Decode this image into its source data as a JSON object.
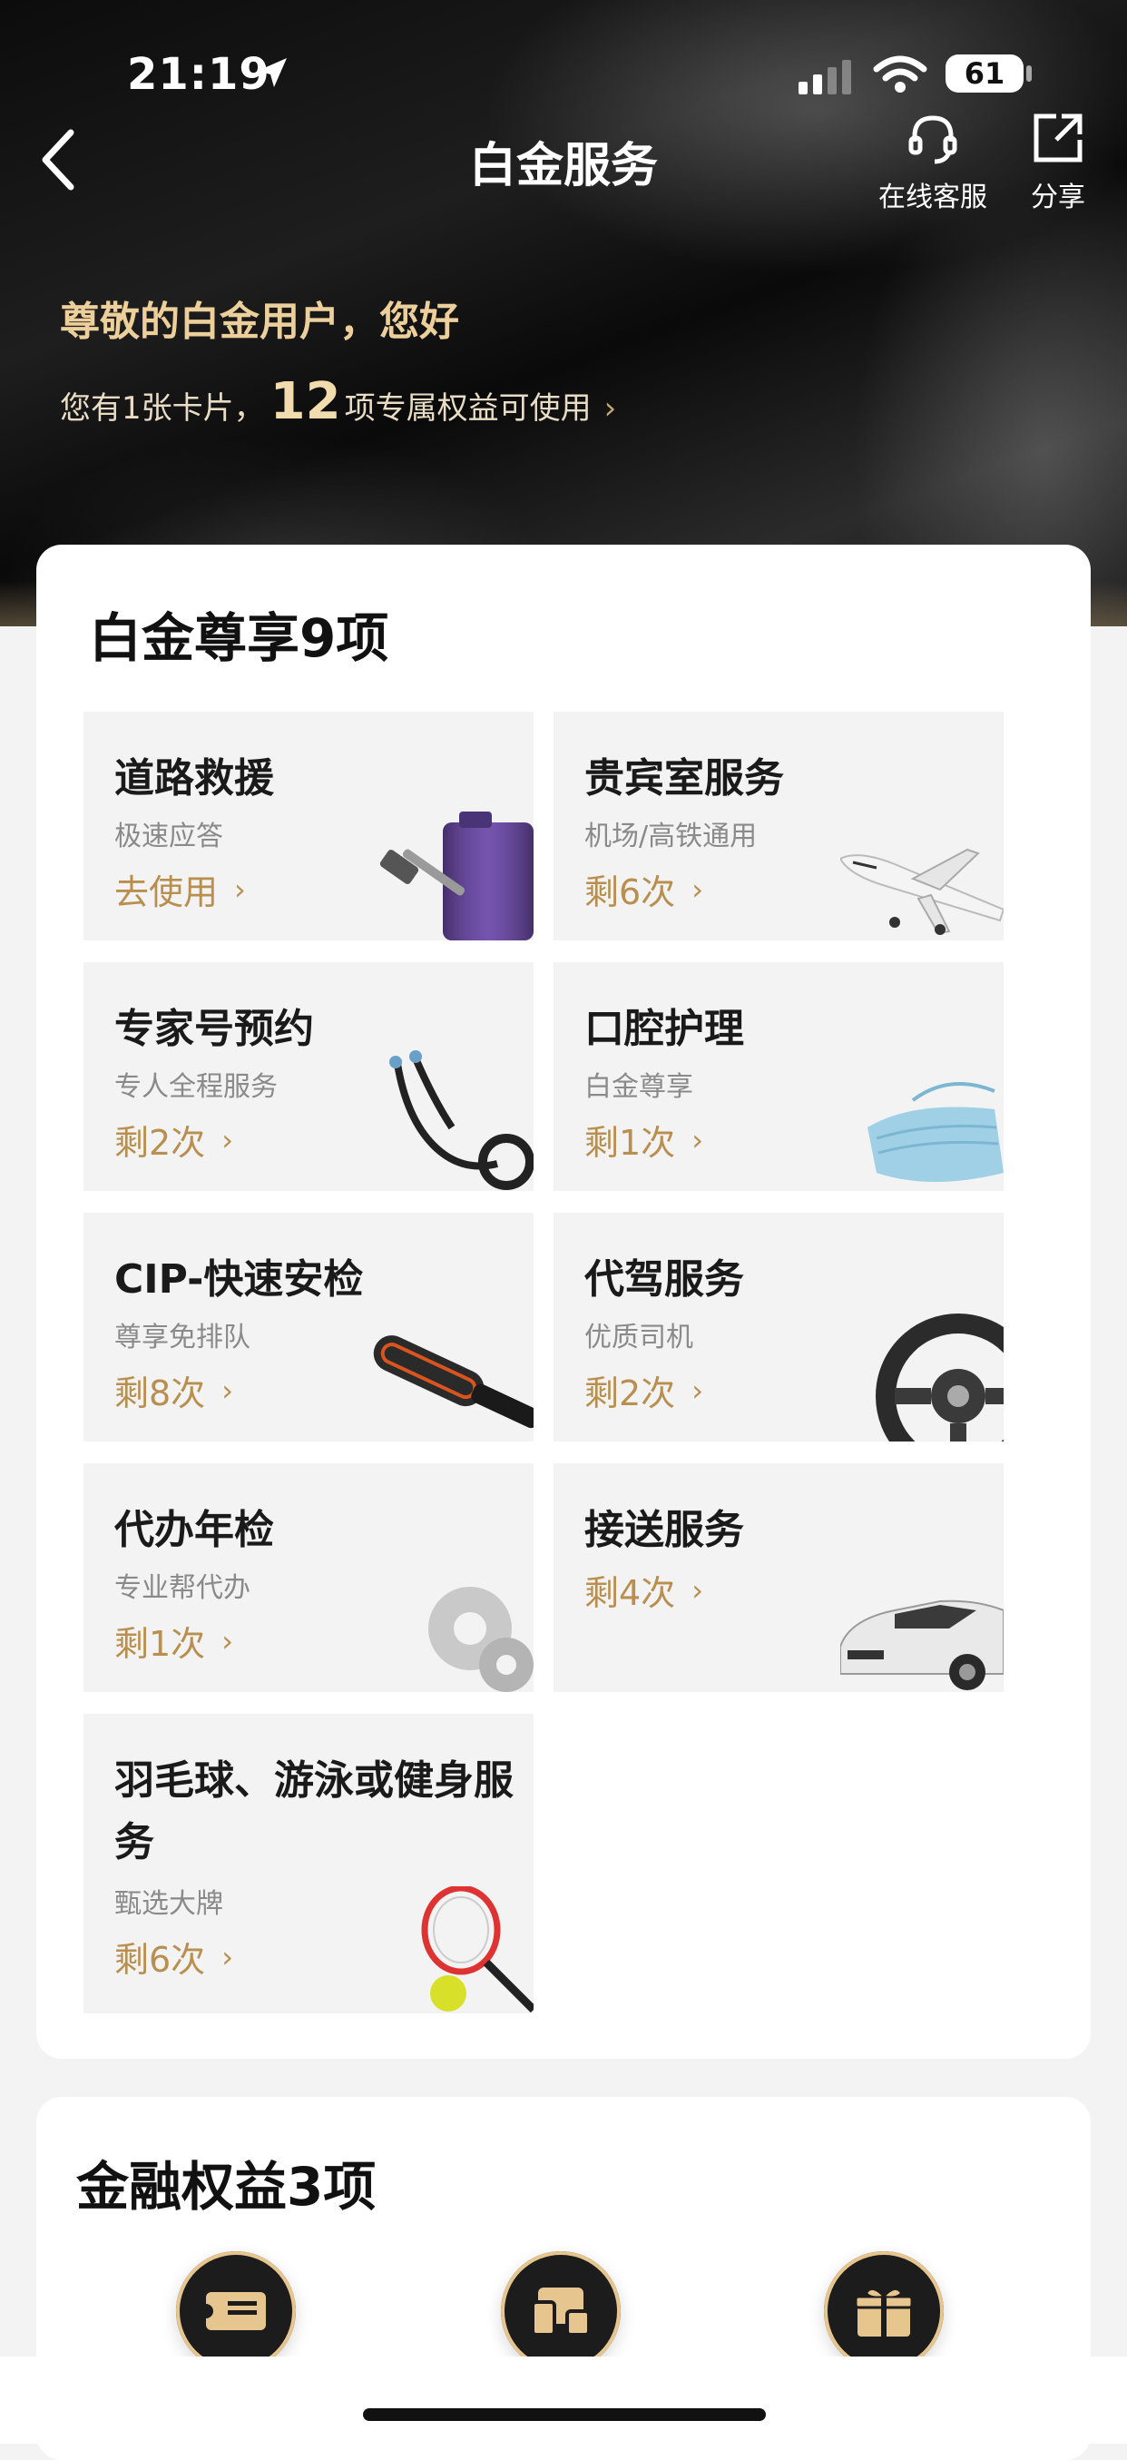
{
  "status_bar": {
    "time": "21:19",
    "battery": "61"
  },
  "nav": {
    "title": "白金服务",
    "actions": [
      {
        "label": "在线客服",
        "icon": "headset-icon"
      },
      {
        "label": "分享",
        "icon": "share-icon"
      }
    ]
  },
  "hero": {
    "greeting": "尊敬的白金用户，您好",
    "summary_prefix": "您有1张卡片，",
    "summary_count": "12",
    "summary_suffix": "项专属权益可使用"
  },
  "section_main": {
    "title": "白金尊享9项",
    "tiles": [
      {
        "title": "道路救援",
        "subtitle": "极速应答",
        "action": "去使用",
        "icon": "jerrycan-hammer-icon"
      },
      {
        "title": "贵宾室服务",
        "subtitle": "机场/高铁通用",
        "action": "剩6次",
        "icon": "airplane-icon"
      },
      {
        "title": "专家号预约",
        "subtitle": "专人全程服务",
        "action": "剩2次",
        "icon": "stethoscope-icon"
      },
      {
        "title": "口腔护理",
        "subtitle": "白金尊享",
        "action": "剩1次",
        "icon": "mask-icon"
      },
      {
        "title": "CIP-快速安检",
        "subtitle": "尊享免排队",
        "action": "剩8次",
        "icon": "security-wand-icon"
      },
      {
        "title": "代驾服务",
        "subtitle": "优质司机",
        "action": "剩2次",
        "icon": "steering-wheel-icon"
      },
      {
        "title": "代办年检",
        "subtitle": "专业帮代办",
        "action": "剩1次",
        "icon": "gears-icon"
      },
      {
        "title": "接送服务",
        "subtitle": "",
        "action": "剩4次",
        "icon": "car-icon"
      },
      {
        "title": "羽毛球、游泳或健身服务",
        "subtitle": "甄选大牌",
        "action": "剩6次",
        "icon": "racket-ball-icon"
      }
    ]
  },
  "section_fin": {
    "title": "金融权益3项",
    "icons": [
      "ticket-icon",
      "devices-icon",
      "gift-icon"
    ]
  },
  "colors": {
    "gold": "#b98f4f",
    "greeting_gold": "#eccf9a",
    "hero_dark": "#111111"
  }
}
